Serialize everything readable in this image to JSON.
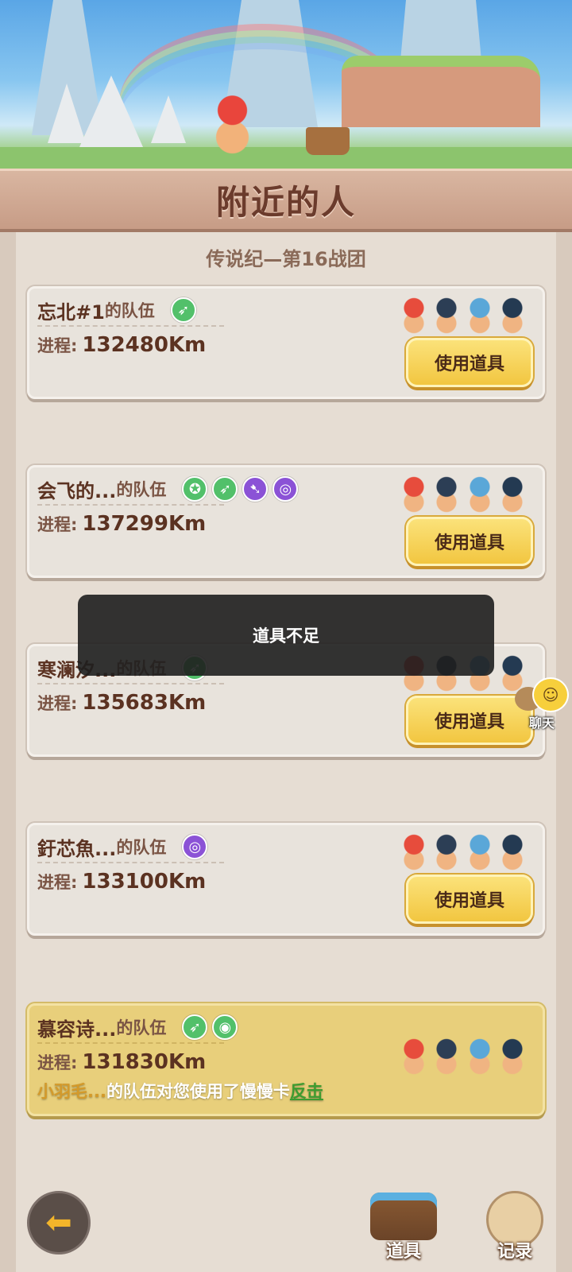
{
  "header": {
    "title": "附近的人",
    "subtitle": "传说纪—第16战团"
  },
  "cards": [
    {
      "name": "忘北#1",
      "suffix": "的队伍",
      "progress_label": "进程:",
      "progress": "132480Km",
      "button": "使用道具",
      "buffs": [
        {
          "icon": "green-run-icon",
          "glyph": "➶",
          "color": "#52c06a"
        }
      ]
    },
    {
      "name": "会飞的...",
      "suffix": "的队伍",
      "progress_label": "进程:",
      "progress": "137299Km",
      "button": "使用道具",
      "buffs": [
        {
          "icon": "green-shield-icon",
          "glyph": "✪",
          "color": "#52c06a"
        },
        {
          "icon": "green-run-icon",
          "glyph": "➶",
          "color": "#52c06a"
        },
        {
          "icon": "purple-run-icon",
          "glyph": "➷",
          "color": "#8b52d6"
        },
        {
          "icon": "purple-snail-icon",
          "glyph": "◎",
          "color": "#8b52d6"
        }
      ]
    },
    {
      "name": "寒澜汐...",
      "suffix": "的队伍",
      "progress_label": "进程:",
      "progress": "135683Km",
      "button": "使用道具",
      "buffs": [
        {
          "icon": "green-run-icon",
          "glyph": "➶",
          "color": "#52c06a"
        }
      ]
    },
    {
      "name": "釪芯魚...",
      "suffix": "的队伍",
      "progress_label": "进程:",
      "progress": "133100Km",
      "button": "使用道具",
      "buffs": [
        {
          "icon": "purple-snail-icon",
          "glyph": "◎",
          "color": "#8b52d6"
        }
      ]
    },
    {
      "name": "慕容诗...",
      "suffix": "的队伍",
      "progress_label": "进程:",
      "progress": "131830Km",
      "buffs": [
        {
          "icon": "green-run-icon",
          "glyph": "➶",
          "color": "#52c06a"
        },
        {
          "icon": "green-swirl-icon",
          "glyph": "◉",
          "color": "#52c06a"
        }
      ],
      "attack": {
        "who": "小羽毛...",
        "text": "的队伍对您使用了慢慢卡",
        "counter": "反击"
      }
    }
  ],
  "toast": "道具不足",
  "chat": {
    "label": "聊天"
  },
  "bottom": {
    "tools_label": "道具",
    "record_label": "记录"
  },
  "colors": {
    "button_yellow": "#f2c640",
    "highlight_card": "#e8cf7b",
    "counter_green": "#3d9c2f"
  }
}
